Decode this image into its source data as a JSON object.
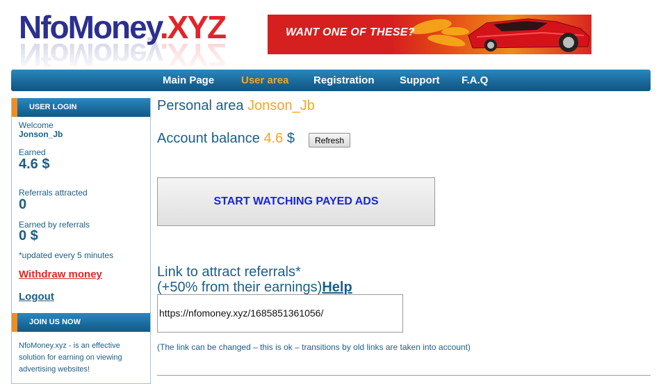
{
  "header": {
    "logo_part1": "NfoMoney",
    "logo_part2": ".XYZ",
    "banner_text": "WANT ONE OF THESE?"
  },
  "nav": {
    "items": [
      {
        "label": "Main Page",
        "active": false
      },
      {
        "label": "User area",
        "active": true
      },
      {
        "label": "Registration",
        "active": false
      },
      {
        "label": "Support",
        "active": false
      },
      {
        "label": "F.A.Q",
        "active": false
      }
    ]
  },
  "sidebar": {
    "login": {
      "title": "USER LOGIN",
      "welcome_label": "Welcome",
      "username": "Jonson_Jb",
      "earned_label": "Earned",
      "earned_value": "4.6 $",
      "referrals_label": "Referrals attracted",
      "referrals_value": "0",
      "earned_by_referrals_label": "Earned by referrals",
      "earned_by_referrals_value": "0 $",
      "update_note": "*updated every 5 minutes",
      "withdraw_link": "Withdraw money",
      "logout_link": "Logout"
    },
    "join": {
      "title": "JOIN US NOW",
      "description": "NfoMoney.xyz - is an effective solution for earning on viewing advertising websites!"
    }
  },
  "main": {
    "personal_label": "Personal area",
    "username": "Jonson_Jb",
    "balance_label": "Account balance",
    "balance_value": "4.6",
    "balance_currency": "$",
    "refresh_button": "Refresh",
    "watch_button": "START WATCHING PAYED ADS",
    "referral_title_line1": "Link to attract referrals*",
    "referral_title_line2": "(+50% from their earnings)",
    "help_link": "Help",
    "referral_link_value": "https://nfomoney.xyz/1685851361056/",
    "referral_note": "(The link can be changed – this is ok – transitions by old links are taken into account)"
  },
  "colors": {
    "nav_blue": "#1a6a9c",
    "accent_orange": "#f5a623",
    "text_blue": "#1b5e86",
    "link_red": "#e0262a"
  }
}
